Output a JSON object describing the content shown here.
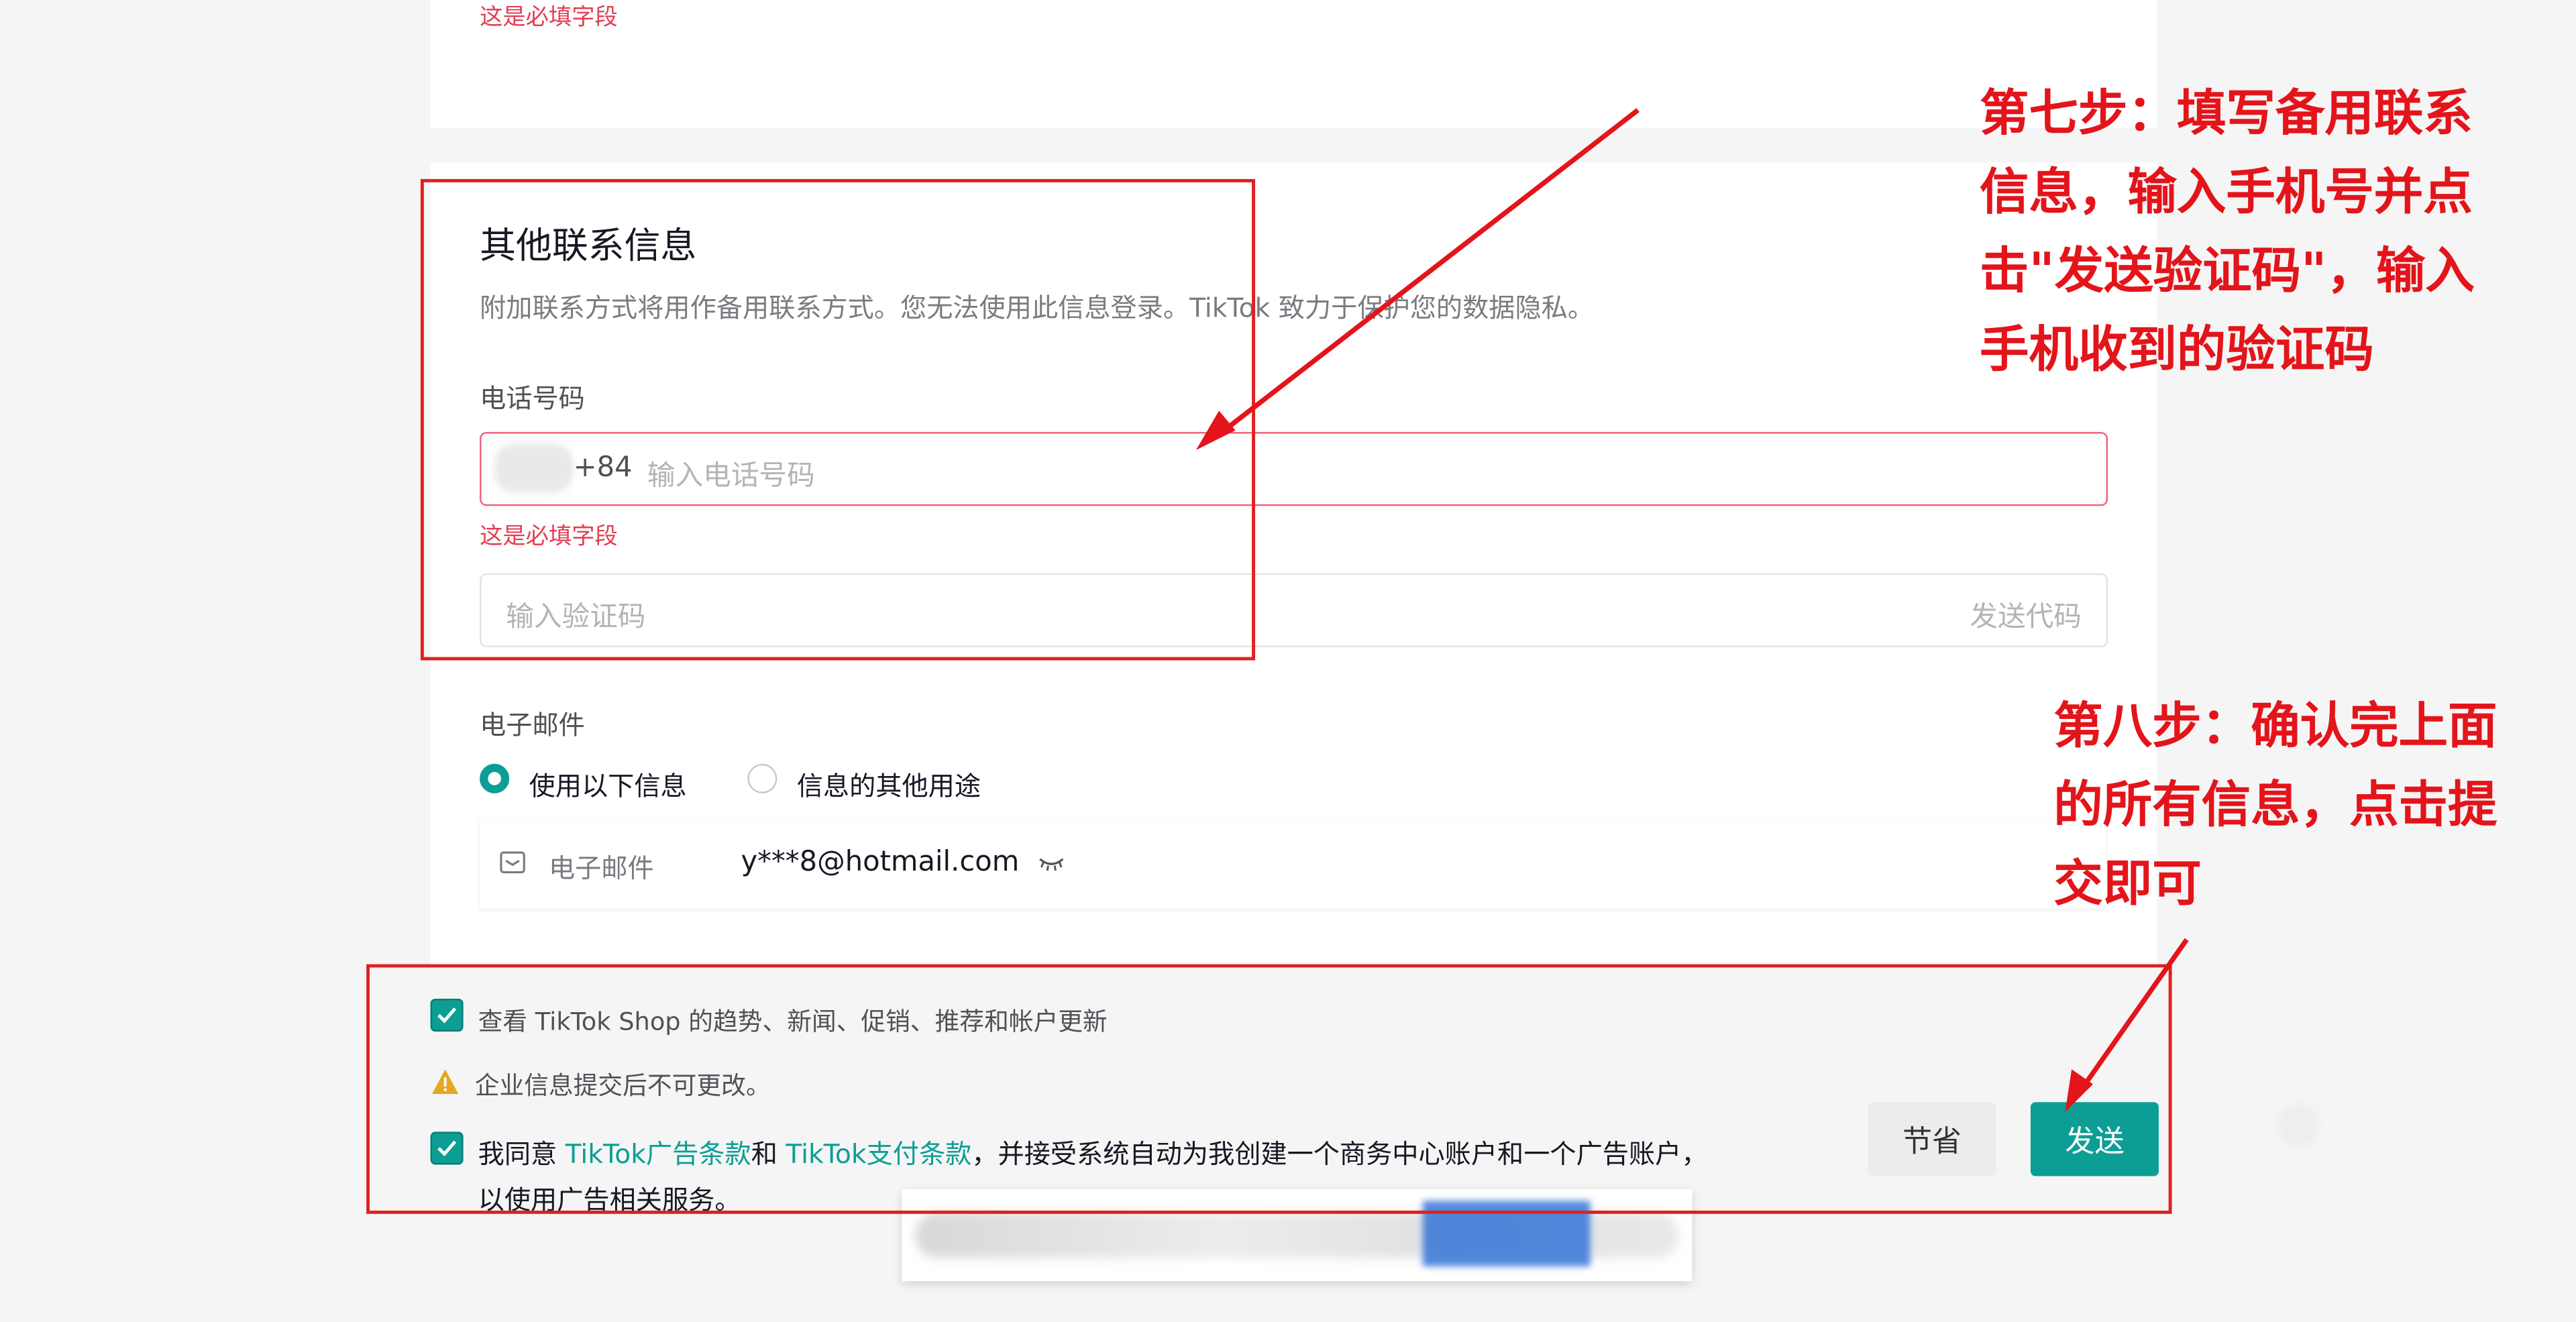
{
  "top_section": {
    "error": "这是必填字段"
  },
  "contact": {
    "title": "其他联系信息",
    "description": "附加联系方式将用作备用联系方式。您无法使用此信息登录。TikTok 致力于保护您的数据隐私。",
    "phone_label": "电话号码",
    "country_code": "+84",
    "phone_placeholder": "输入电话号码",
    "phone_error": "这是必填字段",
    "code_placeholder": "输入验证码",
    "send_code": "发送代码",
    "email_label": "电子邮件",
    "radio_use": "使用以下信息",
    "radio_other": "信息的其他用途",
    "email_field_label": "电子邮件",
    "email_value": "y***8@hotmail.com"
  },
  "footer": {
    "subscribe": "查看 TikTok Shop 的趋势、新闻、促销、推荐和帐户更新",
    "warning": "企业信息提交后不可更改。",
    "agree_prefix": "我同意 ",
    "ads_terms": "TikTok广告条款",
    "and": "和 ",
    "pay_terms": "TikTok支付条款",
    "agree_suffix": "，并接受系统自动为我创建一个商务中心账户和一个广告账户，",
    "agree_line2": "以使用广告相关服务。",
    "save_button": "节省",
    "submit_button": "发送"
  },
  "annotations": {
    "step7": [
      "第七步：填写备用联系",
      "信息，输入手机号并点",
      "击\"发送验证码\"，输入",
      "手机收到的验证码"
    ],
    "step8": [
      "第八步：确认完上面",
      "的所有信息，点击提",
      "交即可"
    ]
  },
  "colors": {
    "accent": "#0c9e94",
    "error": "#e33e52",
    "annotation": "#e4141b"
  }
}
